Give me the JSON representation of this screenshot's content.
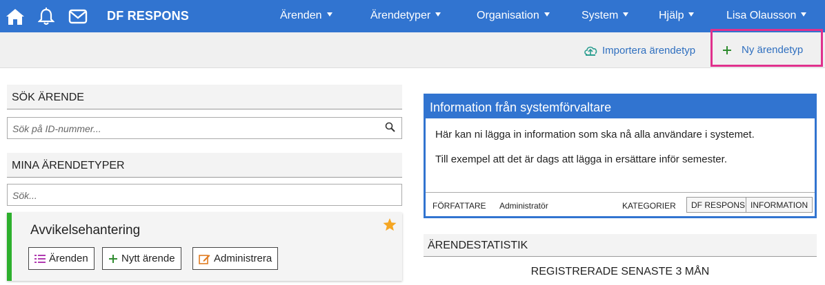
{
  "header": {
    "brand": "DF RESPONS",
    "nav": [
      {
        "label": "Ärenden"
      },
      {
        "label": "Ärendetyper"
      },
      {
        "label": "Organisation"
      },
      {
        "label": "System"
      },
      {
        "label": "Hjälp"
      },
      {
        "label": "Lisa Olausson"
      }
    ]
  },
  "toolbar": {
    "import_label": "Importera ärendetyp",
    "new_label": "Ny ärendetyp"
  },
  "search_case": {
    "title": "SÖK ÄRENDE",
    "placeholder": "Sök på ID-nummer..."
  },
  "my_case_types": {
    "title": "MINA ÄRENDETYPER",
    "placeholder": "Sök...",
    "items": [
      {
        "title": "Avvikelsehantering",
        "buttons": {
          "cases": "Ärenden",
          "new_case": "Nytt ärende",
          "admin": "Administrera"
        }
      }
    ]
  },
  "info": {
    "title": "Information från systemförvaltare",
    "lines": [
      "Här kan ni lägga in information som ska nå alla användare i systemet.",
      "Till exempel att det är dags att lägga in ersättare inför semester."
    ],
    "author_label": "FÖRFATTARE",
    "author": "Administratör",
    "categories_label": "KATEGORIER",
    "tags": [
      "DF RESPONS",
      "INFORMATION"
    ]
  },
  "stats": {
    "title": "ÄRENDESTATISTIK",
    "subtitle": "REGISTRERADE SENASTE 3 MÅN"
  },
  "colors": {
    "primary": "#3174d0",
    "accent_green": "#2eb02e",
    "highlight": "#e0308c",
    "star": "#f5a623"
  }
}
